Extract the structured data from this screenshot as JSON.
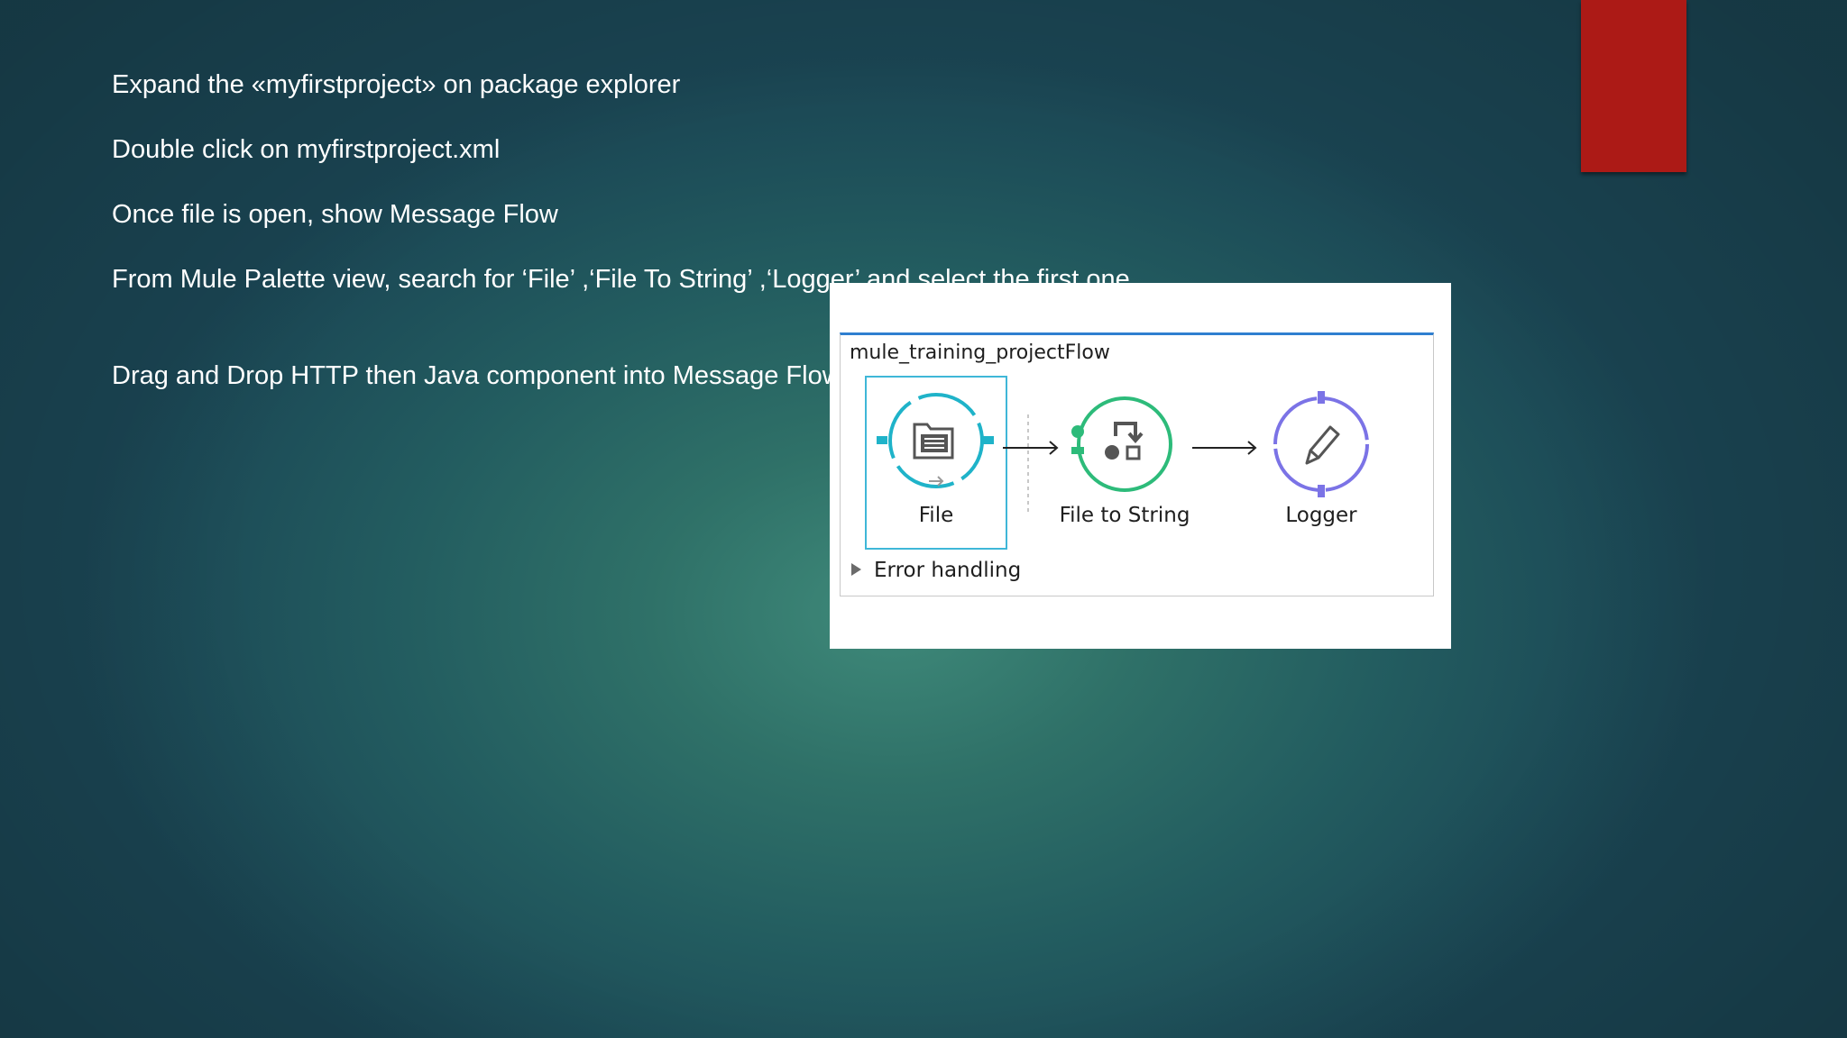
{
  "slide": {
    "bullets": [
      "Expand the «myfirstproject» on package explorer",
      "Double click on myfirstproject.xml",
      "Once file is open, show Message Flow",
      "From Mule Palette view, search for ‘File’  ,‘File To String’ ,‘Logger’ and  select the first one",
      "Drag and Drop HTTP then Java component  into Message Flow"
    ],
    "accent_color": "#ac1a16"
  },
  "flow": {
    "title": "mule_training_projectFlow",
    "components": [
      {
        "label": "File",
        "icon": "folder-list-icon",
        "color": "#1fb3c9",
        "selected": true
      },
      {
        "label": "File to String",
        "icon": "transformer-icon",
        "color": "#2dbb7a",
        "selected": false
      },
      {
        "label": "Logger",
        "icon": "pencil-icon",
        "color": "#7b73e6",
        "selected": false
      }
    ],
    "error_handling_label": "Error handling"
  }
}
